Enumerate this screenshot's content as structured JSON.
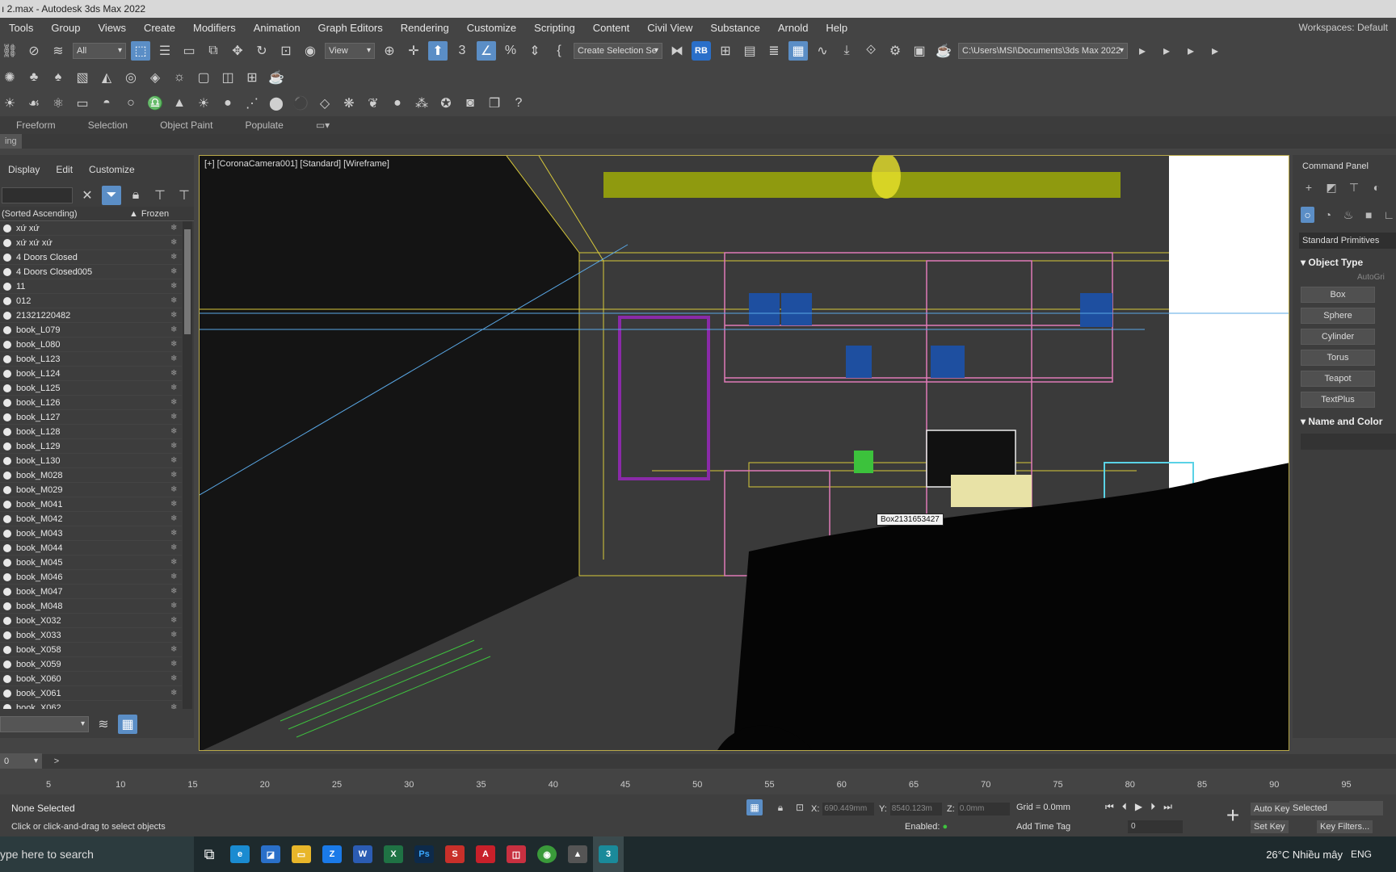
{
  "window": {
    "title": "ı 2.max - Autodesk 3ds Max 2022"
  },
  "menu": {
    "items": [
      "Tools",
      "Group",
      "Views",
      "Create",
      "Modifiers",
      "Animation",
      "Graph Editors",
      "Rendering",
      "Customize",
      "Scripting",
      "Content",
      "Civil View",
      "Substance",
      "Arnold",
      "Help"
    ],
    "workspace_label": "Workspaces: Default"
  },
  "toolbar": {
    "filter_select": "All",
    "view_select": "View",
    "selection_set_select": "Create Selection Se",
    "rb_label": "RB",
    "path_select": "C:\\Users\\MSI\\Documents\\3ds Max 2022"
  },
  "ribbon": {
    "tabs": [
      "Freeform",
      "Selection",
      "Object Paint",
      "Populate"
    ],
    "sub_label": "ing"
  },
  "scene_explorer": {
    "menu": [
      "Display",
      "Edit",
      "Customize"
    ],
    "column_name": "(Sorted Ascending)",
    "column_frozen": "Frozen",
    "items": [
      "xứ xứ",
      "xứ xứ xứ",
      "4 Doors Closed",
      "4 Doors Closed005",
      "11",
      "012",
      "21321220482",
      "book_L079",
      "book_L080",
      "book_L123",
      "book_L124",
      "book_L125",
      "book_L126",
      "book_L127",
      "book_L128",
      "book_L129",
      "book_L130",
      "book_M028",
      "book_M029",
      "book_M041",
      "book_M042",
      "book_M043",
      "book_M044",
      "book_M045",
      "book_M046",
      "book_M047",
      "book_M048",
      "book_X032",
      "book_X033",
      "book_X058",
      "book_X059",
      "book_X060",
      "book_X061",
      "book_X062"
    ]
  },
  "viewport": {
    "label": "[+] [CoronaCamera001] [Standard] [Wireframe]",
    "tooltip": "Box2131653427"
  },
  "command_panel": {
    "title": "Command Panel",
    "category": "Standard Primitives",
    "object_type_title": "Object Type",
    "autogrid": "AutoGri",
    "buttons": [
      "Box",
      "Sphere",
      "Cylinder",
      "Torus",
      "Teapot",
      "TextPlus"
    ],
    "name_color_title": "Name and Color"
  },
  "time": {
    "frame_field": "0",
    "ticks": [
      "5",
      "10",
      "15",
      "20",
      "25",
      "30",
      "35",
      "40",
      "45",
      "50",
      "55",
      "60",
      "65",
      "70",
      "75",
      "80",
      "85",
      "90",
      "95"
    ],
    "tick_values": [
      5,
      10,
      15,
      20,
      25,
      30,
      35,
      40,
      45,
      50,
      55,
      60,
      65,
      70,
      75,
      80,
      85,
      90,
      95
    ]
  },
  "status": {
    "selection": "None Selected",
    "prompt": "Click or click-and-drag to select objects",
    "x_label": "X:",
    "x_value": "690.449mm",
    "y_label": "Y:",
    "y_value": "8540.123m",
    "z_label": "Z:",
    "z_value": "0.0mm",
    "grid": "Grid = 0.0mm",
    "enabled": "Enabled:",
    "add_time_tag": "Add Time Tag",
    "frame": "0",
    "auto_key": "Auto Key",
    "set_key": "Set Key",
    "selected_dropdown": "Selected",
    "key_filters": "Key Filters..."
  },
  "taskbar": {
    "search_placeholder": "ype here to search",
    "weather": "26°C  Nhiều mây",
    "lang": "ENG"
  },
  "colors": {
    "accent": "#5b8ec6",
    "viewport_border": "#b9a94a",
    "wire_yellow": "#d8c93a",
    "wire_pink": "#e07ab8",
    "wire_cyan": "#5ad2e6"
  }
}
